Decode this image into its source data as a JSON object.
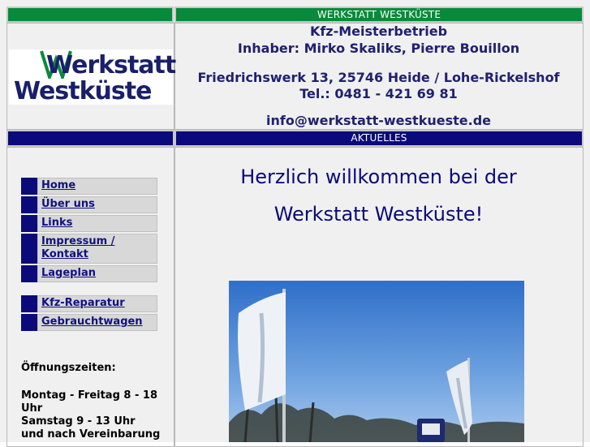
{
  "header": {
    "site_title": "WERKSTATT WESTKÜSTE",
    "section_title": "AKTUELLES"
  },
  "logo": {
    "line1": "Werkstatt",
    "line2": "Westküste"
  },
  "company": {
    "type": "Kfz-Meisterbetrieb",
    "owners": "Inhaber: Mirko Skaliks, Pierre Bouillon",
    "address": "Friedrichswerk 13, 25746 Heide / Lohe-Rickelshof",
    "phone": "Tel.: 0481 - 421 69 81",
    "email": "info@werkstatt-westkueste.de"
  },
  "nav_main": [
    {
      "label": "Home"
    },
    {
      "label": "Über uns"
    },
    {
      "label": "Links"
    },
    {
      "label": "Impressum / Kontakt"
    },
    {
      "label": "Lageplan"
    }
  ],
  "nav_services": [
    {
      "label": "Kfz-Reparatur"
    },
    {
      "label": "Gebrauchtwagen"
    }
  ],
  "hours": {
    "title": "Öffnungszeiten:",
    "weekdays": "Montag - Freitag 8 - 18 Uhr",
    "saturday": "Samstag 9 - 13 Uhr",
    "appointment": "und nach Vereinbarung"
  },
  "welcome": {
    "line1": "Herzlich willkommen bei der",
    "line2": "Werkstatt Westküste!"
  },
  "colors": {
    "green": "#078a3b",
    "navy": "#0a0a7a",
    "text_blue": "#202070"
  }
}
